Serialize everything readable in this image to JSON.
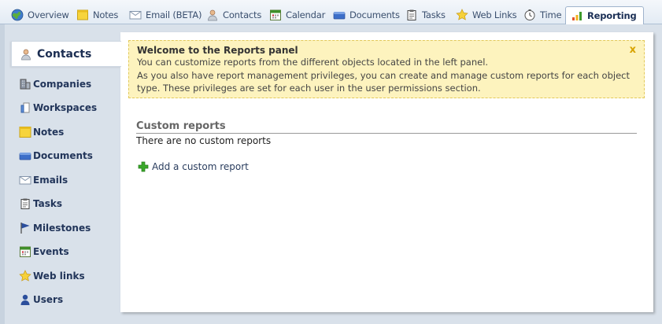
{
  "tabs": [
    {
      "id": "overview",
      "label": "Overview",
      "icon": "globe-icon"
    },
    {
      "id": "notes",
      "label": "Notes",
      "icon": "note-icon"
    },
    {
      "id": "email",
      "label": "Email (BETA)",
      "icon": "envelope-icon"
    },
    {
      "id": "contacts",
      "label": "Contacts",
      "icon": "person-icon"
    },
    {
      "id": "calendar",
      "label": "Calendar",
      "icon": "calendar-icon"
    },
    {
      "id": "documents",
      "label": "Documents",
      "icon": "folder-icon"
    },
    {
      "id": "tasks",
      "label": "Tasks",
      "icon": "clipboard-icon"
    },
    {
      "id": "weblinks",
      "label": "Web Links",
      "icon": "star-icon"
    },
    {
      "id": "time",
      "label": "Time",
      "icon": "clock-icon"
    },
    {
      "id": "reporting",
      "label": "Reporting",
      "icon": "bar-chart-icon",
      "active": true
    }
  ],
  "sidebar": {
    "active": {
      "label": "Contacts",
      "icon": "person-icon"
    },
    "items": [
      {
        "label": "Companies",
        "icon": "building-icon"
      },
      {
        "label": "Workspaces",
        "icon": "workspace-icon"
      },
      {
        "label": "Notes",
        "icon": "note-icon"
      },
      {
        "label": "Documents",
        "icon": "folder-icon"
      },
      {
        "label": "Emails",
        "icon": "envelope-icon"
      },
      {
        "label": "Tasks",
        "icon": "clipboard-icon"
      },
      {
        "label": "Milestones",
        "icon": "flag-icon"
      },
      {
        "label": "Events",
        "icon": "calendar-icon"
      },
      {
        "label": "Web links",
        "icon": "star-icon"
      },
      {
        "label": "Users",
        "icon": "user-icon"
      }
    ]
  },
  "notice": {
    "title": "Welcome to the Reports panel",
    "lines": [
      "You can customize reports from the different objects located in the left panel.",
      "As you also have report management privileges, you can create and manage custom reports for each object",
      "type. These privileges are set for each user in the user permissions section."
    ],
    "close_label": "x"
  },
  "custom_reports": {
    "title": "Custom reports",
    "empty_text": "There are no custom reports",
    "add_label": "Add a custom report"
  },
  "colors": {
    "accent": "#1c2e52",
    "notice_bg": "#fdf3be",
    "notice_border": "#e2c95a",
    "close": "#d8a300",
    "add_icon": "#3aa82a"
  }
}
